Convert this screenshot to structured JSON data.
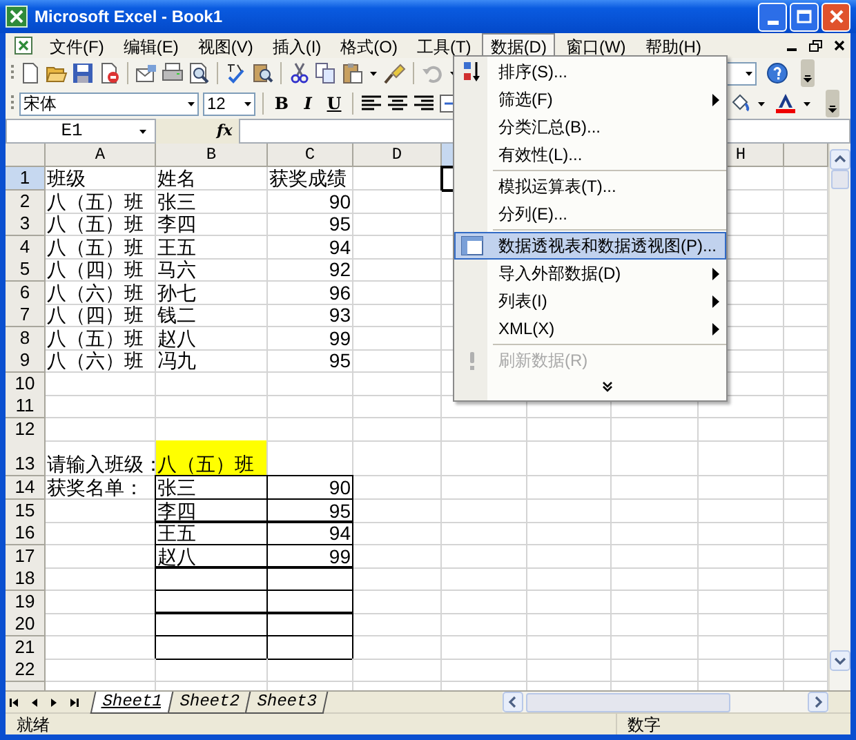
{
  "window": {
    "title": "Microsoft Excel - Book1"
  },
  "menu_bar": [
    {
      "label": "文件(F)",
      "selected": false
    },
    {
      "label": "编辑(E)",
      "selected": false
    },
    {
      "label": "视图(V)",
      "selected": false
    },
    {
      "label": "插入(I)",
      "selected": false
    },
    {
      "label": "格式(O)",
      "selected": false
    },
    {
      "label": "工具(T)",
      "selected": false
    },
    {
      "label": "数据(D)",
      "selected": true
    },
    {
      "label": "窗口(W)",
      "selected": false
    },
    {
      "label": "帮助(H)",
      "selected": false
    }
  ],
  "data_menu": [
    {
      "kind": "item",
      "label": "排序(S)...",
      "submenu": false,
      "selected": false,
      "disabled": false
    },
    {
      "kind": "item",
      "label": "筛选(F)",
      "submenu": true,
      "selected": false,
      "disabled": false
    },
    {
      "kind": "item",
      "label": "分类汇总(B)...",
      "submenu": false,
      "selected": false,
      "disabled": false
    },
    {
      "kind": "item",
      "label": "有效性(L)...",
      "submenu": false,
      "selected": false,
      "disabled": false
    },
    {
      "kind": "separator"
    },
    {
      "kind": "item",
      "label": "模拟运算表(T)...",
      "submenu": false,
      "selected": false,
      "disabled": false
    },
    {
      "kind": "item",
      "label": "分列(E)...",
      "submenu": false,
      "selected": false,
      "disabled": false
    },
    {
      "kind": "separator"
    },
    {
      "kind": "item",
      "label": "数据透视表和数据透视图(P)...",
      "submenu": false,
      "selected": true,
      "disabled": false
    },
    {
      "kind": "item",
      "label": "导入外部数据(D)",
      "submenu": true,
      "selected": false,
      "disabled": false
    },
    {
      "kind": "item",
      "label": "列表(I)",
      "submenu": true,
      "selected": false,
      "disabled": false
    },
    {
      "kind": "item",
      "label": "XML(X)",
      "submenu": true,
      "selected": false,
      "disabled": false
    },
    {
      "kind": "separator"
    },
    {
      "kind": "item",
      "label": "刷新数据(R)",
      "submenu": false,
      "selected": false,
      "disabled": true
    },
    {
      "kind": "more"
    }
  ],
  "formatting": {
    "font": "宋体",
    "size": "12",
    "styles": [
      "B",
      "I",
      "U"
    ]
  },
  "formula_bar": {
    "name_box": "E1",
    "function_label": "fx"
  },
  "columns": [
    {
      "label": "A",
      "selected": false
    },
    {
      "label": "B",
      "selected": false
    },
    {
      "label": "C",
      "selected": false
    },
    {
      "label": "D",
      "selected": false
    },
    {
      "selected": true
    },
    null,
    null,
    {
      "label": "H",
      "selected": false
    },
    {
      "selected": false
    }
  ],
  "rows": [
    {
      "label": "1",
      "selected": true,
      "kind": "normal",
      "boxed": false,
      "cells": [
        {
          "text": "班级",
          "kind": "text"
        },
        {
          "text": "姓名",
          "kind": "text"
        },
        {
          "text": "获奖成绩",
          "kind": "text"
        }
      ]
    },
    {
      "label": "2",
      "selected": false,
      "kind": "normal",
      "boxed": false,
      "cells": [
        {
          "text": "八（五）班",
          "kind": "text"
        },
        {
          "text": "张三",
          "kind": "text"
        },
        {
          "text": "90",
          "kind": "number"
        }
      ]
    },
    {
      "label": "3",
      "selected": false,
      "kind": "normal",
      "boxed": false,
      "cells": [
        {
          "text": "八（五）班",
          "kind": "text"
        },
        {
          "text": "李四",
          "kind": "text"
        },
        {
          "text": "95",
          "kind": "number"
        }
      ]
    },
    {
      "label": "4",
      "selected": false,
      "kind": "normal",
      "boxed": false,
      "cells": [
        {
          "text": "八（五）班",
          "kind": "text"
        },
        {
          "text": "王五",
          "kind": "text"
        },
        {
          "text": "94",
          "kind": "number"
        }
      ]
    },
    {
      "label": "5",
      "selected": false,
      "kind": "normal",
      "boxed": false,
      "cells": [
        {
          "text": "八（四）班",
          "kind": "text"
        },
        {
          "text": "马六",
          "kind": "text"
        },
        {
          "text": "92",
          "kind": "number"
        }
      ]
    },
    {
      "label": "6",
      "selected": false,
      "kind": "normal",
      "boxed": false,
      "cells": [
        {
          "text": "八（六）班",
          "kind": "text"
        },
        {
          "text": "孙七",
          "kind": "text"
        },
        {
          "text": "96",
          "kind": "number"
        }
      ]
    },
    {
      "label": "7",
      "selected": false,
      "kind": "normal",
      "boxed": false,
      "cells": [
        {
          "text": "八（四）班",
          "kind": "text"
        },
        {
          "text": "钱二",
          "kind": "text"
        },
        {
          "text": "93",
          "kind": "number"
        }
      ]
    },
    {
      "label": "8",
      "selected": false,
      "kind": "normal",
      "boxed": false,
      "cells": [
        {
          "text": "八（五）班",
          "kind": "text"
        },
        {
          "text": "赵八",
          "kind": "text"
        },
        {
          "text": "99",
          "kind": "number"
        }
      ]
    },
    {
      "label": "9",
      "selected": false,
      "kind": "normal",
      "boxed": false,
      "cells": [
        {
          "text": "八（六）班",
          "kind": "text"
        },
        {
          "text": "冯九",
          "kind": "text"
        },
        {
          "text": "95",
          "kind": "number"
        }
      ]
    },
    {
      "label": "10",
      "selected": false,
      "kind": "normal",
      "boxed": false
    },
    {
      "label": "11",
      "selected": false,
      "kind": "normal",
      "boxed": false
    },
    {
      "label": "12",
      "selected": false,
      "kind": "normal",
      "boxed": false
    },
    {
      "label": "13",
      "selected": false,
      "kind": "tall",
      "boxed": false,
      "cells": [
        {
          "text": "请输入班级：",
          "kind": "text"
        },
        {
          "text": "八（五）班",
          "kind": "text",
          "color": "#ffff00"
        }
      ]
    },
    {
      "label": "14",
      "selected": false,
      "kind": "normal",
      "boxed": true,
      "cells": [
        {
          "text": "获奖名单：",
          "kind": "text"
        },
        {
          "text": "张三",
          "kind": "text"
        },
        {
          "text": "90",
          "kind": "number"
        }
      ]
    },
    {
      "label": "15",
      "selected": false,
      "kind": "normal",
      "boxed": true,
      "cells": [
        null,
        {
          "text": "李四",
          "kind": "text"
        },
        {
          "text": "95",
          "kind": "number"
        }
      ]
    },
    {
      "label": "16",
      "selected": false,
      "kind": "normal",
      "boxed": true,
      "cells": [
        null,
        {
          "text": "王五",
          "kind": "text"
        },
        {
          "text": "94",
          "kind": "number"
        }
      ]
    },
    {
      "label": "17",
      "selected": false,
      "kind": "normal",
      "boxed": true,
      "cells": [
        null,
        {
          "text": "赵八",
          "kind": "text"
        },
        {
          "text": "99",
          "kind": "number"
        }
      ]
    },
    {
      "label": "18",
      "selected": false,
      "kind": "normal",
      "boxed": true
    },
    {
      "label": "19",
      "selected": false,
      "kind": "normal",
      "boxed": true
    },
    {
      "label": "20",
      "selected": false,
      "kind": "normal",
      "boxed": true
    },
    {
      "label": "21",
      "selected": false,
      "kind": "normal",
      "boxed": true
    },
    {
      "label": "22",
      "selected": false,
      "kind": "normal",
      "boxed": false
    }
  ],
  "sheet_tabs": [
    {
      "label": "Sheet1",
      "selected": true
    },
    {
      "label": "Sheet2",
      "selected": false
    },
    {
      "label": "Sheet3",
      "selected": false
    }
  ],
  "status_bar": {
    "state": "就绪",
    "mode": "数字"
  }
}
